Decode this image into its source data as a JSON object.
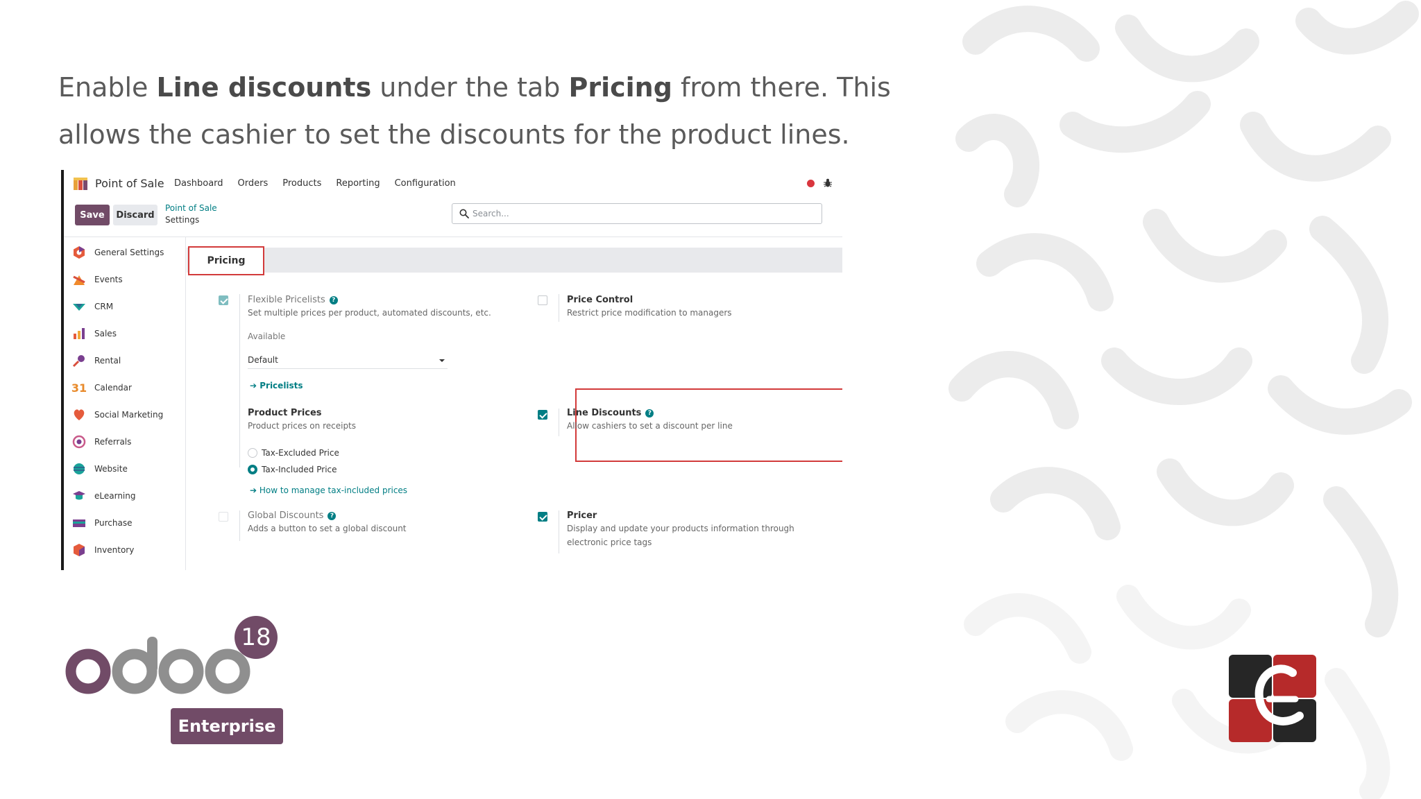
{
  "instruction": {
    "part1": "Enable ",
    "bold1": "Line discounts",
    "part2": " under the tab ",
    "bold2": "Pricing",
    "part3": " from there. This allows the cashier to set the discounts for the product lines."
  },
  "app": {
    "title": "Point of Sale",
    "menu": [
      "Dashboard",
      "Orders",
      "Products",
      "Reporting",
      "Configuration"
    ]
  },
  "actions": {
    "save": "Save",
    "discard": "Discard",
    "breadcrumb_parent": "Point of Sale",
    "breadcrumb_current": "Settings",
    "search_placeholder": "Search..."
  },
  "sidebar": {
    "items": [
      {
        "label": "General Settings",
        "icon": "general-settings-icon"
      },
      {
        "label": "Events",
        "icon": "events-icon"
      },
      {
        "label": "CRM",
        "icon": "crm-icon"
      },
      {
        "label": "Sales",
        "icon": "sales-icon"
      },
      {
        "label": "Rental",
        "icon": "rental-icon"
      },
      {
        "label": "Calendar",
        "icon": "calendar-icon"
      },
      {
        "label": "Social Marketing",
        "icon": "social-marketing-icon"
      },
      {
        "label": "Referrals",
        "icon": "referrals-icon"
      },
      {
        "label": "Website",
        "icon": "website-icon"
      },
      {
        "label": "eLearning",
        "icon": "elearning-icon"
      },
      {
        "label": "Purchase",
        "icon": "purchase-icon"
      },
      {
        "label": "Inventory",
        "icon": "inventory-icon"
      }
    ],
    "calendar_glyph": "31"
  },
  "section": {
    "tab": "Pricing"
  },
  "settings": {
    "flexible_pricelists": {
      "title": "Flexible Pricelists",
      "desc": "Set multiple prices per product, automated discounts, etc.",
      "checked": true
    },
    "available_label": "Available",
    "available_value": "Default",
    "pricelists_link": "Pricelists",
    "price_control": {
      "title": "Price Control",
      "desc": "Restrict price modification to managers",
      "checked": false
    },
    "product_prices": {
      "title": "Product Prices",
      "desc": "Product prices on receipts"
    },
    "tax_excluded": "Tax-Excluded Price",
    "tax_included": "Tax-Included Price",
    "tax_help_link": "How to manage tax-included prices",
    "line_discounts": {
      "title": "Line Discounts",
      "desc": "Allow cashiers to set a discount per line",
      "checked": true
    },
    "global_discounts": {
      "title": "Global Discounts",
      "desc": "Adds a button to set a global discount",
      "checked": false
    },
    "pricer": {
      "title": "Pricer",
      "desc1": "Display and update your products information through",
      "desc2": "electronic price tags",
      "checked": true
    }
  },
  "branding": {
    "version": "18",
    "edition": "Enterprise",
    "accent": "#714b67",
    "teal": "#017e84",
    "highlight": "#d23a3a"
  }
}
